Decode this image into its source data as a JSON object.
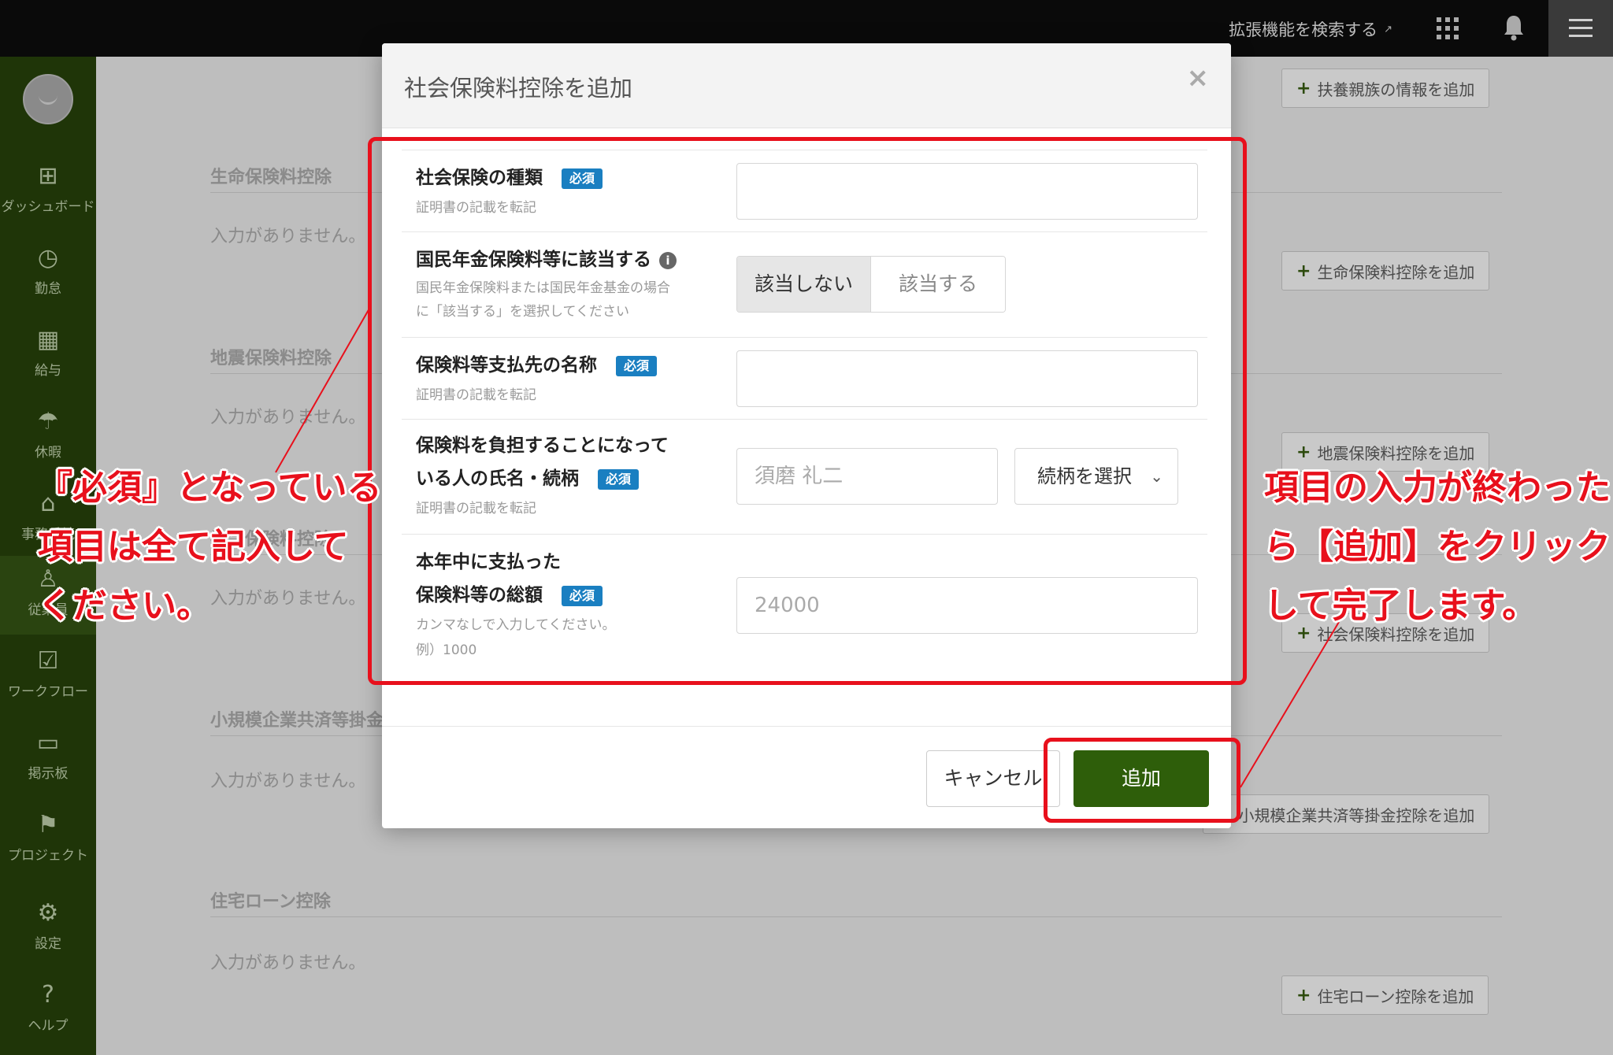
{
  "topbar": {
    "ext_link": "拡張機能を検索する",
    "ext_icon": "external-link-icon",
    "icons": [
      "apps-grid-icon",
      "bell-icon",
      "hamburger-menu-icon"
    ]
  },
  "sidebar": {
    "items": [
      {
        "label": "ダッシュボード",
        "icon": "dashboard-icon"
      },
      {
        "label": "勤怠",
        "icon": "clock-icon"
      },
      {
        "label": "給与",
        "icon": "calculator-icon"
      },
      {
        "label": "休暇",
        "icon": "umbrella-icon"
      },
      {
        "label": "事務手続",
        "icon": "home-icon"
      },
      {
        "label": "従業員",
        "icon": "person-icon"
      },
      {
        "label": "ワークフロー",
        "icon": "checklist-icon"
      },
      {
        "label": "掲示板",
        "icon": "message-icon"
      },
      {
        "label": "プロジェクト",
        "icon": "flag-icon"
      },
      {
        "label": "設定",
        "icon": "gear-icon"
      },
      {
        "label": "ヘルプ",
        "icon": "help-icon"
      }
    ]
  },
  "background": {
    "add_dependent": "扶養親族の情報を追加",
    "sections": [
      {
        "title": "生命保険料控除",
        "empty": "入力がありません。",
        "add": "生命保険料控除を追加"
      },
      {
        "title": "地震保険料控除",
        "empty": "入力がありません。",
        "add": "地震保険料控除を追加"
      },
      {
        "title": "社会保険料控除",
        "empty": "入力がありません。",
        "add": "社会保険料控除を追加"
      },
      {
        "title": "小規模企業共済等掛金控除",
        "empty": "入力がありません。",
        "add": "小規模企業共済等掛金控除を追加"
      },
      {
        "title": "住宅ローン控除",
        "empty": "入力がありません。",
        "add": "住宅ローン控除を追加"
      }
    ]
  },
  "modal": {
    "title": "社会保険料控除を追加",
    "close": "×",
    "required": "必須",
    "fields": {
      "type": {
        "label": "社会保険の種類",
        "sub": "証明書の記載を転記",
        "value": ""
      },
      "pension": {
        "label": "国民年金保険料等に該当する",
        "sub1": "国民年金保険料または国民年金基金の場合",
        "sub2": "に「該当する」を選択してください",
        "opt_no": "該当しない",
        "opt_yes": "該当する"
      },
      "payee": {
        "label": "保険料等支払先の名称",
        "sub": "証明書の記載を転記",
        "value": ""
      },
      "payer": {
        "label1": "保険料を負担することになって",
        "label2": "いる人の氏名・続柄",
        "sub": "証明書の記載を転記",
        "name_placeholder": "須磨 礼二",
        "relation": "続柄を選択"
      },
      "total": {
        "label1": "本年中に支払った",
        "label2": "保険料等の総額",
        "sub1": "カンマなしで入力してください。",
        "sub2": "例）1000",
        "placeholder": "24000"
      }
    },
    "cancel": "キャンセル",
    "add": "追加"
  },
  "annotations": {
    "left": [
      "『必須』となっている",
      "項目は全て記入して",
      "ください。"
    ],
    "right": [
      "項目の入力が終わった",
      "ら【追加】をクリック",
      "して完了します。"
    ]
  }
}
